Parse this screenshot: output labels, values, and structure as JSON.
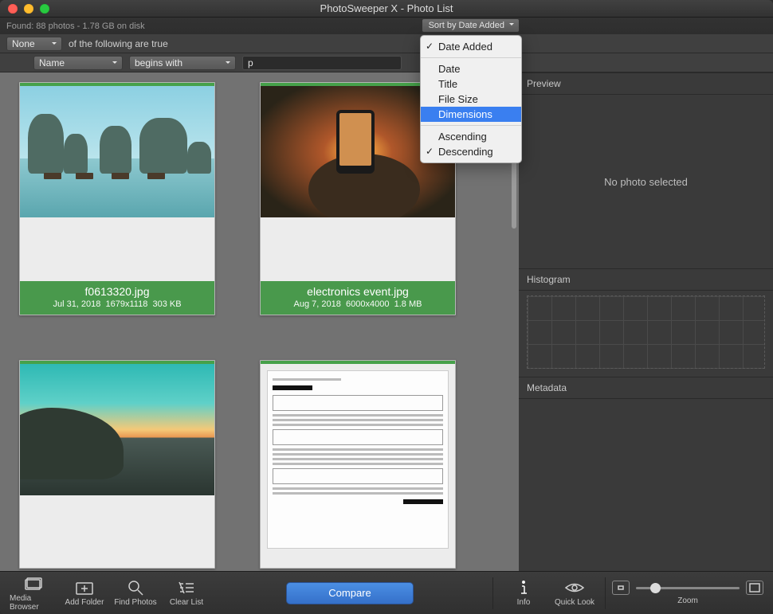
{
  "window": {
    "title": "PhotoSweeper X - Photo List"
  },
  "status": {
    "found": "Found: 88 photos - 1.78 GB on disk"
  },
  "sort_button": {
    "label": "Sort by Date Added"
  },
  "sort_menu": {
    "items": [
      {
        "label": "Date Added",
        "checked": true
      },
      {
        "label": "Date"
      },
      {
        "label": "Title"
      },
      {
        "label": "File Size"
      },
      {
        "label": "Dimensions",
        "highlighted": true
      }
    ],
    "order": [
      {
        "label": "Ascending"
      },
      {
        "label": "Descending",
        "checked": true
      }
    ]
  },
  "filter": {
    "match_mode": "None",
    "tail": "of the following are true",
    "attr": "Name",
    "op": "begins with",
    "value": "p"
  },
  "photos": [
    {
      "file": "f0613320.jpg",
      "date": "Jul 31, 2018",
      "dims": "1679x1118",
      "size": "303 KB"
    },
    {
      "file": "electronics event.jpg",
      "date": "Aug 7, 2018",
      "dims": "6000x4000",
      "size": "1.8 MB"
    }
  ],
  "side": {
    "preview_hdr": "Preview",
    "preview_empty": "No photo selected",
    "histogram_hdr": "Histogram",
    "metadata_hdr": "Metadata"
  },
  "toolbar": {
    "media_browser": "Media Browser",
    "add_folder": "Add Folder",
    "find_photos": "Find Photos",
    "clear_list": "Clear List",
    "compare": "Compare",
    "info": "Info",
    "quick_look": "Quick Look",
    "zoom": "Zoom"
  }
}
